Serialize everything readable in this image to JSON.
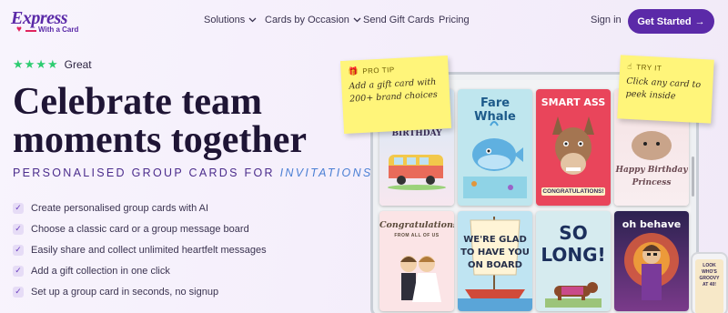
{
  "nav": {
    "logo_main": "Express",
    "logo_sub": "With a Card",
    "links": [
      {
        "label": "Solutions",
        "has_dropdown": true
      },
      {
        "label": "Cards by Occasion",
        "has_dropdown": true
      },
      {
        "label": "Send Gift Cards",
        "has_dropdown": false
      },
      {
        "label": "Pricing",
        "has_dropdown": false
      }
    ],
    "signin": "Sign in",
    "cta": "Get Started",
    "cta_arrow": "→"
  },
  "hero": {
    "stars": "★★★★",
    "rating_label": "Great",
    "headline_line1": "Celebrate team",
    "headline_line2": "moments together",
    "subhead_prefix": "PERSONALISED GROUP CARDS FOR ",
    "subhead_accent": "INVITATIONS",
    "features": [
      "Create personalised group cards with AI",
      "Choose a classic card or a group message board",
      "Easily share and collect unlimited heartfelt messages",
      "Add a gift collection in one click",
      "Set up a group card in seconds, no signup"
    ]
  },
  "notes": {
    "pro_tip_tag": "PRO TIP",
    "pro_tip_text_1": "Add a gift card with",
    "pro_tip_text_2": "200+ brand choices",
    "try_it_tag": "TRY IT",
    "try_it_text_1": "Click any card to",
    "try_it_text_2": "peek inside"
  },
  "cards": {
    "c1": "BIRTHDAY",
    "c2": "Fare Whale",
    "c3_line1": "SMART ASS",
    "c3_line2": "CONGRATULATIONS!",
    "c4_line1": "Happy Birthday",
    "c4_line2": "Princess",
    "c5_line1": "Congratulations",
    "c5_line2": "FROM ALL OF US",
    "c6_line1": "WE'RE GLAD",
    "c6_line2": "TO HAVE YOU",
    "c6_line3": "ON BOARD",
    "c7_line1": "SO",
    "c7_line2": "LONG!",
    "c8": "oh behave"
  },
  "phone": {
    "text_1": "LOOK WHO'S",
    "text_2": "GROOVY",
    "text_3": "AT 40!"
  },
  "colors": {
    "brand": "#5b2aa8",
    "star": "#2ecc71",
    "accent_blue": "#4a7fd4",
    "note": "#fff57a"
  }
}
